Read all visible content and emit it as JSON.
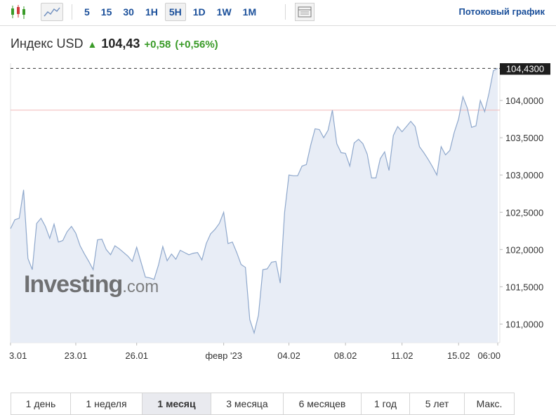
{
  "toolbar": {
    "timeframes": [
      "5",
      "15",
      "30",
      "1H",
      "5H",
      "1D",
      "1W",
      "1M"
    ],
    "active_timeframe": "5H",
    "stream_link": "Потоковый график"
  },
  "quote": {
    "name": "Индекс USD",
    "last": "104,43",
    "change": "+0,58",
    "change_pct": "(+0,56%)",
    "direction_icon": "arrow-up-icon"
  },
  "watermark": {
    "brand": "Investing",
    "suffix": ".com"
  },
  "ranges": [
    "1 день",
    "1 неделя",
    "1 месяц",
    "3 месяца",
    "6 месяцев",
    "1 год",
    "5 лет",
    "Макс."
  ],
  "active_range": "1 месяц",
  "colors": {
    "line": "#8fa8cc",
    "fill": "#e8edf6",
    "positive": "#3a9b28",
    "link": "#1a4f9a",
    "ref_line": "#f2b8b8"
  },
  "chart_data": {
    "type": "area",
    "title": "",
    "xlabel": "",
    "ylabel": "",
    "ylim": [
      100.75,
      104.5
    ],
    "yticks": [
      "101,0000",
      "101,5000",
      "102,0000",
      "102,5000",
      "103,0000",
      "103,5000",
      "104,0000"
    ],
    "ytick_values": [
      101.0,
      101.5,
      102.0,
      102.5,
      103.0,
      103.5,
      104.0
    ],
    "xticks": [
      "3.01",
      "23.01",
      "26.01",
      "февр '23",
      "04.02",
      "08.02",
      "11.02",
      "15.02",
      "06:00"
    ],
    "xtick_index": [
      0,
      15,
      29,
      49,
      64,
      77,
      90,
      103,
      112
    ],
    "last_label": "104,4300",
    "last_value": 104.43,
    "reference_value": 103.87,
    "grid": false,
    "values": [
      102.28,
      102.4,
      102.42,
      102.8,
      101.88,
      101.73,
      102.35,
      102.42,
      102.31,
      102.15,
      102.34,
      102.1,
      102.12,
      102.24,
      102.31,
      102.22,
      102.05,
      101.94,
      101.84,
      101.73,
      102.13,
      102.14,
      102.0,
      101.93,
      102.05,
      102.01,
      101.96,
      101.91,
      101.84,
      102.03,
      101.83,
      101.63,
      101.62,
      101.6,
      101.79,
      102.04,
      101.85,
      101.94,
      101.87,
      101.99,
      101.96,
      101.93,
      101.95,
      101.96,
      101.86,
      102.08,
      102.21,
      102.27,
      102.35,
      102.5,
      102.08,
      102.1,
      101.96,
      101.8,
      101.76,
      101.06,
      100.88,
      101.12,
      101.73,
      101.74,
      101.83,
      101.84,
      101.55,
      102.5,
      103.0,
      102.99,
      102.99,
      103.12,
      103.14,
      103.4,
      103.62,
      103.61,
      103.5,
      103.6,
      103.87,
      103.42,
      103.3,
      103.29,
      103.12,
      103.43,
      103.48,
      103.42,
      103.28,
      102.96,
      102.96,
      103.22,
      103.31,
      103.06,
      103.53,
      103.65,
      103.58,
      103.65,
      103.72,
      103.65,
      103.38,
      103.3,
      103.21,
      103.11,
      103.0,
      103.38,
      103.27,
      103.33,
      103.57,
      103.75,
      104.05,
      103.9,
      103.64,
      103.66,
      104.0,
      103.85,
      104.1,
      104.4,
      104.43
    ]
  }
}
